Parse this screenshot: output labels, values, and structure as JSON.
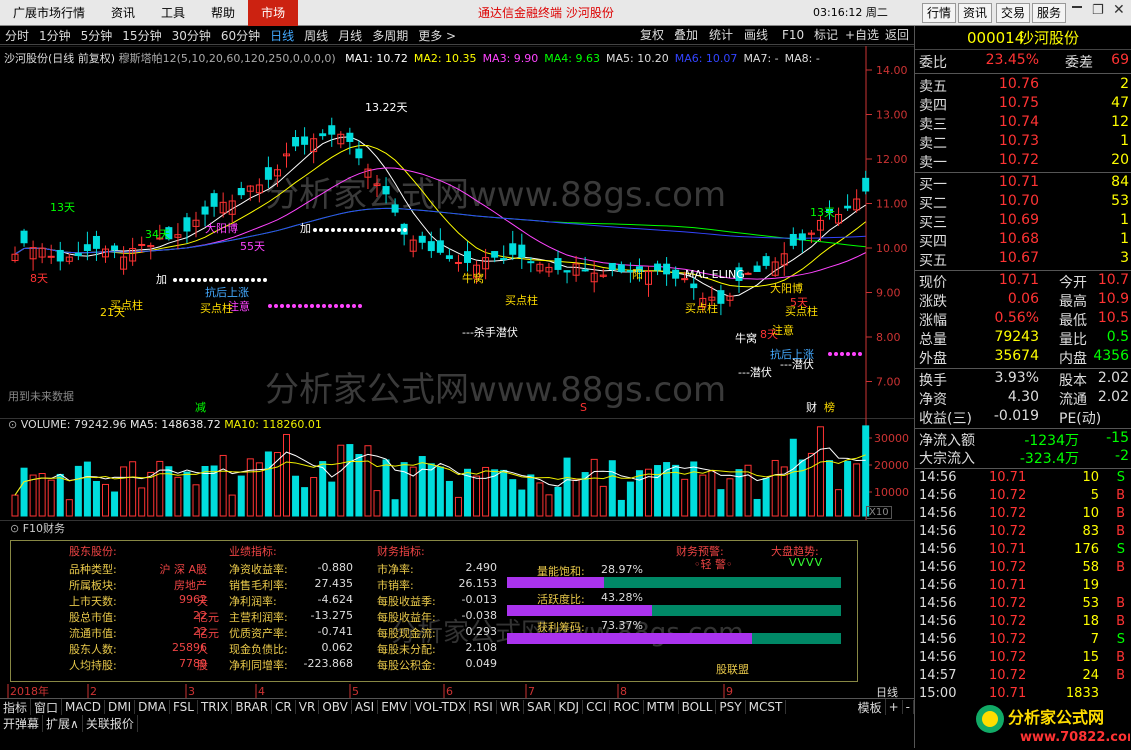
{
  "menu": {
    "items": [
      "广展市场行情",
      "资讯",
      "工具",
      "帮助",
      "市场"
    ],
    "app_title": "通达信金融终端  沙河股份",
    "clock": "03:16:12 周二",
    "right_buttons": [
      "行情",
      "资讯",
      "交易",
      "服务"
    ]
  },
  "toolbar": {
    "periods": [
      "分时",
      "1分钟",
      "5分钟",
      "15分钟",
      "30分钟",
      "60分钟",
      "日线",
      "周线",
      "月线",
      "多周期",
      "更多 >"
    ],
    "active_period": "日线",
    "tools": [
      "复权",
      "叠加",
      "统计",
      "画线",
      "F10",
      "标记",
      "+自选",
      "返回"
    ]
  },
  "chart": {
    "title": "沙河股份(日线 前复权)",
    "indicator": "穆斯塔帕12(5,10,20,60,120,250,0,0,0,0)",
    "ma": [
      {
        "label": "MA1: 10.72",
        "color": "#ffffff"
      },
      {
        "label": "MA2: 10.35",
        "color": "#ffff00"
      },
      {
        "label": "MA3: 9.90",
        "color": "#ff44ff"
      },
      {
        "label": "MA4: 9.63",
        "color": "#00ff00"
      },
      {
        "label": "MA5: 10.20",
        "color": "#dddddd"
      },
      {
        "label": "MA6: 10.07",
        "color": "#3344ff"
      },
      {
        "label": "MA7: -",
        "color": "#dddddd"
      },
      {
        "label": "MA8: -",
        "color": "#dddddd"
      }
    ],
    "y_ticks": [
      "14.00",
      "13.00",
      "12.00",
      "11.00",
      "10.00",
      "9.00",
      "8.00",
      "7.00"
    ],
    "watermark": "分析家公式网www.88gs.com",
    "future_text": "用到未来数据",
    "annotations": [
      "13.22天",
      "13天",
      "13天",
      "34天",
      "55天",
      "21天",
      "8天",
      "5天",
      "8天",
      "大阳博",
      "大阳博",
      "抗后上涨",
      "抗后上涨",
      "注意",
      "注意",
      "买点柱",
      "买点柱",
      "买点柱",
      "买点柱",
      "买点柱",
      "牛窝",
      "牛窝",
      "---杀手潜伏",
      "---潜伏",
      "---潜伏",
      "MAL ELING",
      "阳",
      "加",
      "加",
      "减",
      "S",
      "财",
      "榜"
    ]
  },
  "volume": {
    "title": "VOLUME: 79242.96",
    "ma5": "MA5: 148638.72",
    "ma10": "MA10: 118260.01",
    "y_ticks": [
      "30000",
      "20000",
      "10000"
    ],
    "unit": "X10"
  },
  "f10": {
    "tab_label": "F10财务",
    "sections": {
      "holder_hdr": "股东股份:",
      "perf_hdr": "业绩指标:",
      "fin_hdr": "财务指标:",
      "alert_hdr": "财务预警:",
      "trend_hdr": "大盘趋势:"
    },
    "holder": [
      {
        "k": "品种类型:",
        "v": "沪 深 A股",
        "u": ""
      },
      {
        "k": "所属板块:",
        "v": "房地产",
        "u": ""
      },
      {
        "k": "上市天数:",
        "v": "9962",
        "u": "天"
      },
      {
        "k": "股总市值:",
        "v": "22",
        "u": "亿元"
      },
      {
        "k": "流通市值:",
        "v": "22",
        "u": "亿元"
      },
      {
        "k": "股东人数:",
        "v": "25896",
        "u": "人"
      },
      {
        "k": "人均持股:",
        "v": "7789",
        "u": "股"
      }
    ],
    "perf": [
      {
        "k": "净资收益率:",
        "v": "-0.880"
      },
      {
        "k": "销售毛利率:",
        "v": "27.435"
      },
      {
        "k": "净利润率:",
        "v": "-4.624"
      },
      {
        "k": "主营利润率:",
        "v": "-13.275"
      },
      {
        "k": "优质资产率:",
        "v": "-0.741"
      },
      {
        "k": "现金负债比:",
        "v": "0.062"
      },
      {
        "k": "净利同增率:",
        "v": "-223.868"
      }
    ],
    "fin": [
      {
        "k": "市净率:",
        "v": "2.490"
      },
      {
        "k": "市销率:",
        "v": "26.153"
      },
      {
        "k": "每股收益季:",
        "v": "-0.013"
      },
      {
        "k": "每股收益年:",
        "v": "-0.038"
      },
      {
        "k": "每股现金流:",
        "v": "0.293"
      },
      {
        "k": "每股未分配:",
        "v": "2.108"
      },
      {
        "k": "每股公积金:",
        "v": "0.049"
      }
    ],
    "gauges": [
      {
        "label": "量能饱和:",
        "value": "28.97%",
        "fraction": 0.2897
      },
      {
        "label": "活跃度比:",
        "value": "43.28%",
        "fraction": 0.4328
      },
      {
        "label": "获利筹码:",
        "value": "73.37%",
        "fraction": 0.7337
      }
    ],
    "alert": "◦轻 警◦",
    "trend_arrows": "VVVV",
    "brand": "股联盟"
  },
  "date_axis": [
    "2018年",
    "2",
    "3",
    "4",
    "5",
    "6",
    "7",
    "8",
    "9"
  ],
  "period_label": "日线",
  "tabs": [
    "指标",
    "窗口",
    "MACD",
    "DMI",
    "DMA",
    "FSL",
    "TRIX",
    "BRAR",
    "CR",
    "VR",
    "OBV",
    "ASI",
    "EMV",
    "VOL-TDX",
    "RSI",
    "WR",
    "SAR",
    "KDJ",
    "CCI",
    "ROC",
    "MTM",
    "BOLL",
    "PSY",
    "MCST"
  ],
  "tabs_right": [
    "模板",
    "+",
    "-"
  ],
  "tabs2": [
    "开弹幕",
    "扩展∧",
    "关联报价"
  ],
  "quote": {
    "code": "000014",
    "name": "沙河股份",
    "wb_k": "委比",
    "wb_v": "23.45%",
    "wc_k": "委差",
    "wc_v": "69",
    "asks": [
      {
        "k": "卖五",
        "p": "10.76",
        "v": "2"
      },
      {
        "k": "卖四",
        "p": "10.75",
        "v": "47"
      },
      {
        "k": "卖三",
        "p": "10.74",
        "v": "12"
      },
      {
        "k": "卖二",
        "p": "10.73",
        "v": "1"
      },
      {
        "k": "卖一",
        "p": "10.72",
        "v": "20"
      }
    ],
    "bids": [
      {
        "k": "买一",
        "p": "10.71",
        "v": "84"
      },
      {
        "k": "买二",
        "p": "10.70",
        "v": "53"
      },
      {
        "k": "买三",
        "p": "10.69",
        "v": "1"
      },
      {
        "k": "买四",
        "p": "10.68",
        "v": "1"
      },
      {
        "k": "买五",
        "p": "10.67",
        "v": "3"
      }
    ],
    "stats": [
      {
        "k": "现价",
        "v": "10.71",
        "k2": "今开",
        "v2": "10.7"
      },
      {
        "k": "涨跌",
        "v": "0.06",
        "k2": "最高",
        "v2": "10.9"
      },
      {
        "k": "涨幅",
        "v": "0.56%",
        "k2": "最低",
        "v2": "10.5"
      },
      {
        "k": "总量",
        "v": "79243",
        "k2": "量比",
        "v2": "0.5"
      },
      {
        "k": "外盘",
        "v": "35674",
        "k2": "内盘",
        "v2": "4356"
      }
    ],
    "stats2": [
      {
        "k": "换手",
        "v": "3.93%",
        "k2": "股本",
        "v2": "2.02"
      },
      {
        "k": "净资",
        "v": "4.30",
        "k2": "流通",
        "v2": "2.02"
      },
      {
        "k": "收益(三)",
        "v": "-0.019",
        "k2": "PE(动)",
        "v2": ""
      }
    ],
    "flow": [
      {
        "k": "净流入额",
        "v": "-1234万",
        "v2": "-15"
      },
      {
        "k": "大宗流入",
        "v": "-323.4万",
        "v2": "-2"
      }
    ],
    "ticks": [
      {
        "t": "14:56",
        "p": "10.71",
        "v": "10",
        "s": "S"
      },
      {
        "t": "14:56",
        "p": "10.72",
        "v": "5",
        "s": "B"
      },
      {
        "t": "14:56",
        "p": "10.72",
        "v": "10",
        "s": "B"
      },
      {
        "t": "14:56",
        "p": "10.72",
        "v": "83",
        "s": "B"
      },
      {
        "t": "14:56",
        "p": "10.71",
        "v": "176",
        "s": "S"
      },
      {
        "t": "14:56",
        "p": "10.72",
        "v": "58",
        "s": "B"
      },
      {
        "t": "14:56",
        "p": "10.71",
        "v": "19",
        "s": ""
      },
      {
        "t": "14:56",
        "p": "10.72",
        "v": "53",
        "s": "B"
      },
      {
        "t": "14:56",
        "p": "10.72",
        "v": "18",
        "s": "B"
      },
      {
        "t": "14:56",
        "p": "10.72",
        "v": "7",
        "s": "S"
      },
      {
        "t": "14:56",
        "p": "10.72",
        "v": "15",
        "s": "B"
      },
      {
        "t": "14:57",
        "p": "10.72",
        "v": "24",
        "s": "B"
      },
      {
        "t": "15:00",
        "p": "10.71",
        "v": "1833",
        "s": ""
      }
    ]
  },
  "logo": {
    "name": "分析家公式网",
    "url": "www.70822.com"
  }
}
